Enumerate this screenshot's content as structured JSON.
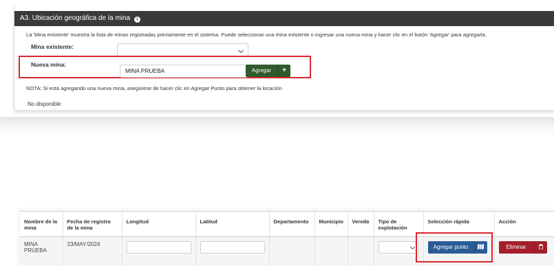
{
  "section": {
    "title": "A3. Ubicación geográfica de la mina",
    "info_icon": "info-circle-icon",
    "description": "La 'Mina existente' muestra la lista de minas registradas previamente en el sistema. Puede seleccionar una mina existente o ingresar una nueva mina y hacer clic en el botón 'Agregar' para agregarla.",
    "existing_mine_label": "Mina existente:",
    "existing_mine_value": "",
    "new_mine_label": "Nueva mina:",
    "new_mine_value": "MINA PRUEBA",
    "add_button_label": "Agregar",
    "add_button_icon": "plus-icon",
    "note": "NOTA: Si está agregando una nueva mina, asegúrese de hacer clic en Agregar Punto para obtener la locación.",
    "status": "No disponible"
  },
  "table": {
    "headers": [
      "Nombre de la mina",
      "Fecha de registro de la mina",
      "Longitud",
      "Latitud",
      "Departamento",
      "Municipio",
      "Vereda",
      "Tipo de explotación",
      "Selección rápida",
      "Acción"
    ],
    "rows": [
      {
        "name": "MINA PRUEBA",
        "date": "23/MAY/2024",
        "longitude": "",
        "latitude": "",
        "department": "",
        "municipality": "",
        "vereda": "",
        "exploitation_type": "",
        "quick_select_label": "Agregar punto",
        "quick_select_icon": "map-icon",
        "delete_label": "Eliminar",
        "delete_icon": "trash-icon"
      }
    ]
  },
  "colors": {
    "header_bg": "#3a3a3a",
    "highlight_border": "#d9262e",
    "add_button": "#2f5a2c",
    "point_button": "#2a5c96",
    "delete_button": "#a51e2b"
  }
}
